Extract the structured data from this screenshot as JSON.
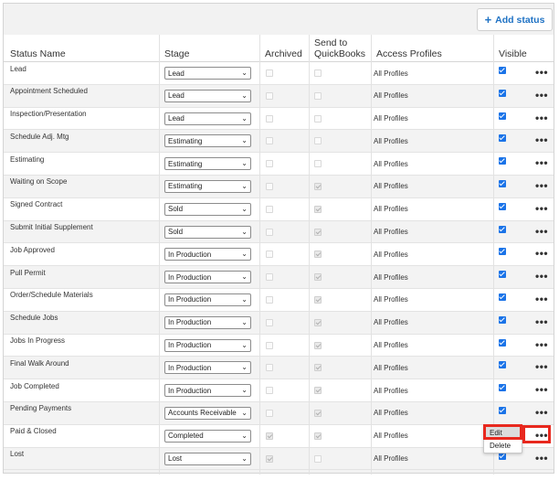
{
  "toolbar": {
    "add_status_label": "Add status",
    "add_icon": "plus-icon"
  },
  "columns": {
    "status_name": "Status Name",
    "stage": "Stage",
    "archived": "Archived",
    "send_to_qb_line1": "Send to",
    "send_to_qb_line2": "QuickBooks",
    "access_profiles": "Access Profiles",
    "visible": "Visible"
  },
  "rows": [
    {
      "name": "Lead",
      "stage": "Lead",
      "archived": false,
      "send_to_qb": false,
      "send_to_qb_checked": false,
      "profiles": "All Profiles",
      "visible": true
    },
    {
      "name": "Appointment Scheduled",
      "stage": "Lead",
      "archived": false,
      "send_to_qb": false,
      "send_to_qb_checked": false,
      "profiles": "All Profiles",
      "visible": true
    },
    {
      "name": "Inspection/Presentation",
      "stage": "Lead",
      "archived": false,
      "send_to_qb": false,
      "send_to_qb_checked": false,
      "profiles": "All Profiles",
      "visible": true
    },
    {
      "name": "Schedule Adj. Mtg",
      "stage": "Estimating",
      "archived": false,
      "send_to_qb": false,
      "send_to_qb_checked": false,
      "profiles": "All Profiles",
      "visible": true
    },
    {
      "name": "Estimating",
      "stage": "Estimating",
      "archived": false,
      "send_to_qb": false,
      "send_to_qb_checked": false,
      "profiles": "All Profiles",
      "visible": true
    },
    {
      "name": "Waiting on Scope",
      "stage": "Estimating",
      "archived": false,
      "send_to_qb": false,
      "send_to_qb_checked": true,
      "profiles": "All Profiles",
      "visible": true
    },
    {
      "name": "Signed Contract",
      "stage": "Sold",
      "archived": false,
      "send_to_qb": false,
      "send_to_qb_checked": true,
      "profiles": "All Profiles",
      "visible": true
    },
    {
      "name": "Submit Initial Supplement",
      "stage": "Sold",
      "archived": false,
      "send_to_qb": false,
      "send_to_qb_checked": true,
      "profiles": "All Profiles",
      "visible": true
    },
    {
      "name": "Job Approved",
      "stage": "In Production",
      "archived": false,
      "send_to_qb": false,
      "send_to_qb_checked": true,
      "profiles": "All Profiles",
      "visible": true
    },
    {
      "name": "Pull Permit",
      "stage": "In Production",
      "archived": false,
      "send_to_qb": false,
      "send_to_qb_checked": true,
      "profiles": "All Profiles",
      "visible": true
    },
    {
      "name": "Order/Schedule Materials",
      "stage": "In Production",
      "archived": false,
      "send_to_qb": false,
      "send_to_qb_checked": true,
      "profiles": "All Profiles",
      "visible": true
    },
    {
      "name": "Schedule Jobs",
      "stage": "In Production",
      "archived": false,
      "send_to_qb": false,
      "send_to_qb_checked": true,
      "profiles": "All Profiles",
      "visible": true
    },
    {
      "name": "Jobs In Progress",
      "stage": "In Production",
      "archived": false,
      "send_to_qb": false,
      "send_to_qb_checked": true,
      "profiles": "All Profiles",
      "visible": true
    },
    {
      "name": "Final Walk Around",
      "stage": "In Production",
      "archived": false,
      "send_to_qb": false,
      "send_to_qb_checked": true,
      "profiles": "All Profiles",
      "visible": true
    },
    {
      "name": "Job Completed",
      "stage": "In Production",
      "archived": false,
      "send_to_qb": false,
      "send_to_qb_checked": true,
      "profiles": "All Profiles",
      "visible": true
    },
    {
      "name": "Pending Payments",
      "stage": "Accounts Receivable",
      "archived": false,
      "send_to_qb": false,
      "send_to_qb_checked": true,
      "profiles": "All Profiles",
      "visible": true
    },
    {
      "name": "Paid & Closed",
      "stage": "Completed",
      "archived": true,
      "send_to_qb": false,
      "send_to_qb_checked": true,
      "profiles": "All Profiles",
      "visible": true
    },
    {
      "name": "Lost",
      "stage": "Lost",
      "archived": true,
      "send_to_qb": false,
      "send_to_qb_checked": false,
      "profiles": "All Profiles",
      "visible": true
    }
  ],
  "context_menu": {
    "edit_label": "Edit",
    "delete_label": "Delete"
  },
  "colors": {
    "accent": "#1f72c4",
    "checkbox_checked": "#1a73e8",
    "highlight": "#e8281e",
    "row_alt": "#f3f3f3"
  }
}
